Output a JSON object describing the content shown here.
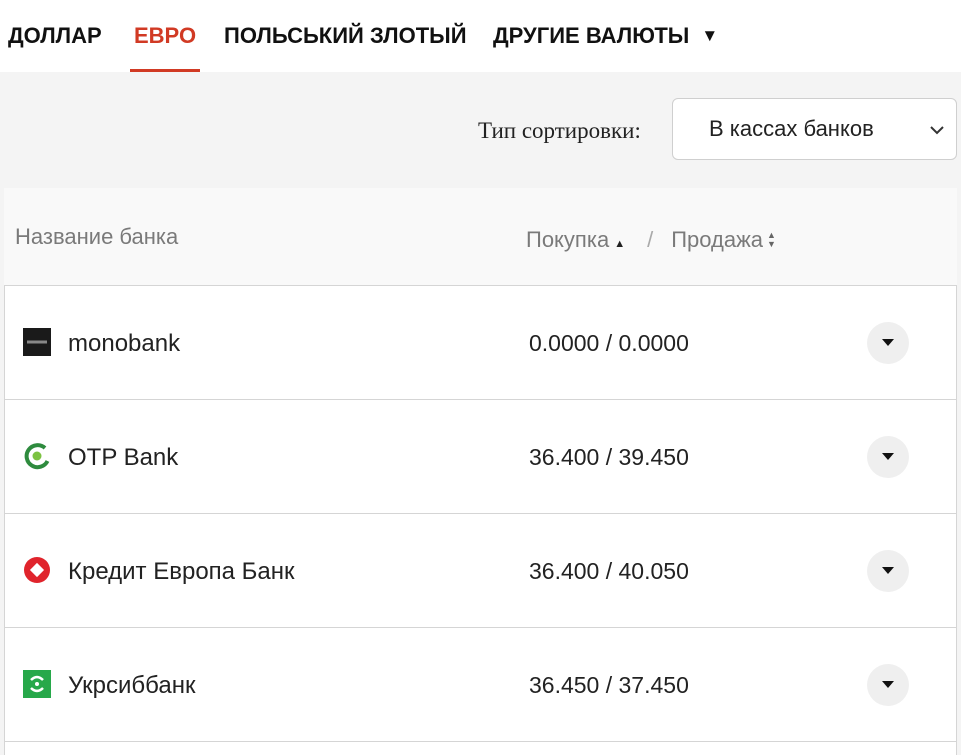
{
  "tabs": [
    {
      "label": "ДОЛЛАР",
      "active": false
    },
    {
      "label": "ЕВРО",
      "active": true
    },
    {
      "label": "ПОЛЬСЬКИЙ ЗЛОТЫЙ",
      "active": false
    },
    {
      "label": "ДРУГИЕ ВАЛЮТЫ",
      "active": false
    }
  ],
  "sort": {
    "label": "Тип сортировки:",
    "selected": "В кассах банков"
  },
  "table_header": {
    "bank_col": "Название банка",
    "buy_col": "Покупка",
    "separator": "/",
    "sell_col": "Продажа"
  },
  "banks": [
    {
      "name": "monobank",
      "rate": "0.0000 / 0.0000",
      "logo": "monobank-logo"
    },
    {
      "name": "OTP Bank",
      "rate": "36.400 / 39.450",
      "logo": "otp-bank-logo"
    },
    {
      "name": "Кредит Европа Банк",
      "rate": "36.400 / 40.050",
      "logo": "credit-europe-logo"
    },
    {
      "name": "Укрсиббанк",
      "rate": "36.450 / 37.450",
      "logo": "ukrsibbank-logo"
    }
  ],
  "colors": {
    "accent": "#d13a24",
    "otp_green": "#2e8b3e",
    "credit_europe_red": "#e0242c",
    "ukrsib_green": "#27a84a"
  }
}
